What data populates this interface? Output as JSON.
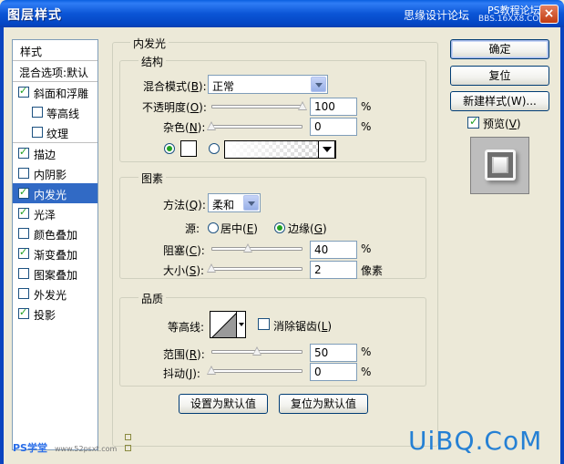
{
  "window": {
    "title": "图层样式",
    "watermark_top": "思缘设计论坛",
    "watermark_ps": "PS教程论坛",
    "watermark_bbs": "BBS.16XX8.COM",
    "close_label": "×"
  },
  "sidebar": {
    "header": "样式",
    "blend_options": "混合选项:默认",
    "items": [
      {
        "label": "斜面和浮雕",
        "checked": true
      },
      {
        "label": "等高线",
        "checked": false
      },
      {
        "label": "纹理",
        "checked": false
      },
      {
        "label": "描边",
        "checked": true
      },
      {
        "label": "内阴影",
        "checked": false
      },
      {
        "label": "内发光",
        "checked": true,
        "selected": true
      },
      {
        "label": "光泽",
        "checked": true
      },
      {
        "label": "颜色叠加",
        "checked": false
      },
      {
        "label": "渐变叠加",
        "checked": true
      },
      {
        "label": "图案叠加",
        "checked": false
      },
      {
        "label": "外发光",
        "checked": false
      },
      {
        "label": "投影",
        "checked": true
      }
    ],
    "logo": "PS学堂",
    "logo_site": "www.52psxt.com"
  },
  "panel": {
    "title": "内发光",
    "structure": {
      "title": "结构",
      "blend_mode_label": "混合模式(B):",
      "blend_mode_prefix": "混合模式(",
      "blend_mode_key": "B",
      "blend_mode_suffix": "):",
      "blend_mode_value": "正常",
      "opacity_prefix": "不透明度(",
      "opacity_key": "O",
      "opacity_suffix": "):",
      "opacity_value": "100",
      "noise_prefix": "杂色(",
      "noise_key": "N",
      "noise_suffix": "):",
      "noise_value": "0",
      "percent": "%",
      "opacity_level": 1.0,
      "noise_level": 0.0
    },
    "elements": {
      "title": "图素",
      "technique_prefix": "方法(",
      "technique_key": "Q",
      "technique_suffix": "):",
      "technique_value": "柔和",
      "source_label": "源:",
      "center_prefix": "居中(",
      "center_key": "E",
      "center_suffix": ")",
      "edge_prefix": "边缘(",
      "edge_key": "G",
      "edge_suffix": ")",
      "choke_prefix": "阻塞(",
      "choke_key": "C",
      "choke_suffix": "):",
      "choke_value": "40",
      "size_prefix": "大小(",
      "size_key": "S",
      "size_suffix": "):",
      "size_value": "2",
      "size_unit": "像素",
      "percent": "%",
      "choke_level": 0.4,
      "size_level": 0.0
    },
    "quality": {
      "title": "品质",
      "contour_label": "等高线:",
      "antialias_prefix": "消除锯齿(",
      "antialias_key": "L",
      "antialias_suffix": ")",
      "range_prefix": "范围(",
      "range_key": "R",
      "range_suffix": "):",
      "range_value": "50",
      "jitter_prefix": "抖动(",
      "jitter_key": "J",
      "jitter_suffix": "):",
      "jitter_value": "0",
      "percent": "%",
      "range_level": 0.5,
      "jitter_level": 0.0
    },
    "make_default": "设置为默认值",
    "reset_default": "复位为默认值"
  },
  "actions": {
    "ok": "确定",
    "reset": "复位",
    "new_style": "新建样式(W)...",
    "preview_prefix": "预览(",
    "preview_key": "V",
    "preview_suffix": ")"
  },
  "watermark_bottom": "UiBQ.CoM",
  "colors": {
    "title_bar": "#0b55d6",
    "selection": "#316ac5",
    "check": "#21a121",
    "watermark": "#2580d4"
  }
}
